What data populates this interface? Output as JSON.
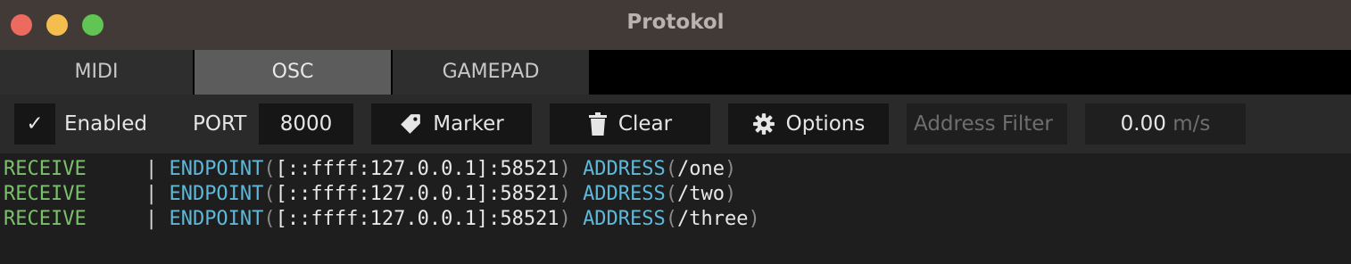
{
  "window": {
    "title": "Protokol"
  },
  "tabs": [
    {
      "label": "MIDI"
    },
    {
      "label": "OSC",
      "active": true
    },
    {
      "label": "GAMEPAD"
    }
  ],
  "toolbar": {
    "enabled_check": "✓",
    "enabled_label": "Enabled",
    "port_label": "PORT",
    "port_value": "8000",
    "marker_label": "Marker",
    "clear_label": "Clear",
    "options_label": "Options",
    "filter_placeholder": "Address Filter",
    "rate_value": "0.00",
    "rate_unit": "m/s"
  },
  "log": [
    {
      "kind": "RECEIVE",
      "sep": "|",
      "endpoint_key": "ENDPOINT",
      "endpoint": "[::ffff:127.0.0.1]:58521",
      "address_key": "ADDRESS",
      "address": "/one"
    },
    {
      "kind": "RECEIVE",
      "sep": "|",
      "endpoint_key": "ENDPOINT",
      "endpoint": "[::ffff:127.0.0.1]:58521",
      "address_key": "ADDRESS",
      "address": "/two"
    },
    {
      "kind": "RECEIVE",
      "sep": "|",
      "endpoint_key": "ENDPOINT",
      "endpoint": "[::ffff:127.0.0.1]:58521",
      "address_key": "ADDRESS",
      "address": "/three"
    }
  ],
  "colors": {
    "receive": "#7bc06a",
    "keyword": "#5db8d9",
    "active_tab": "#5c5c5c"
  }
}
